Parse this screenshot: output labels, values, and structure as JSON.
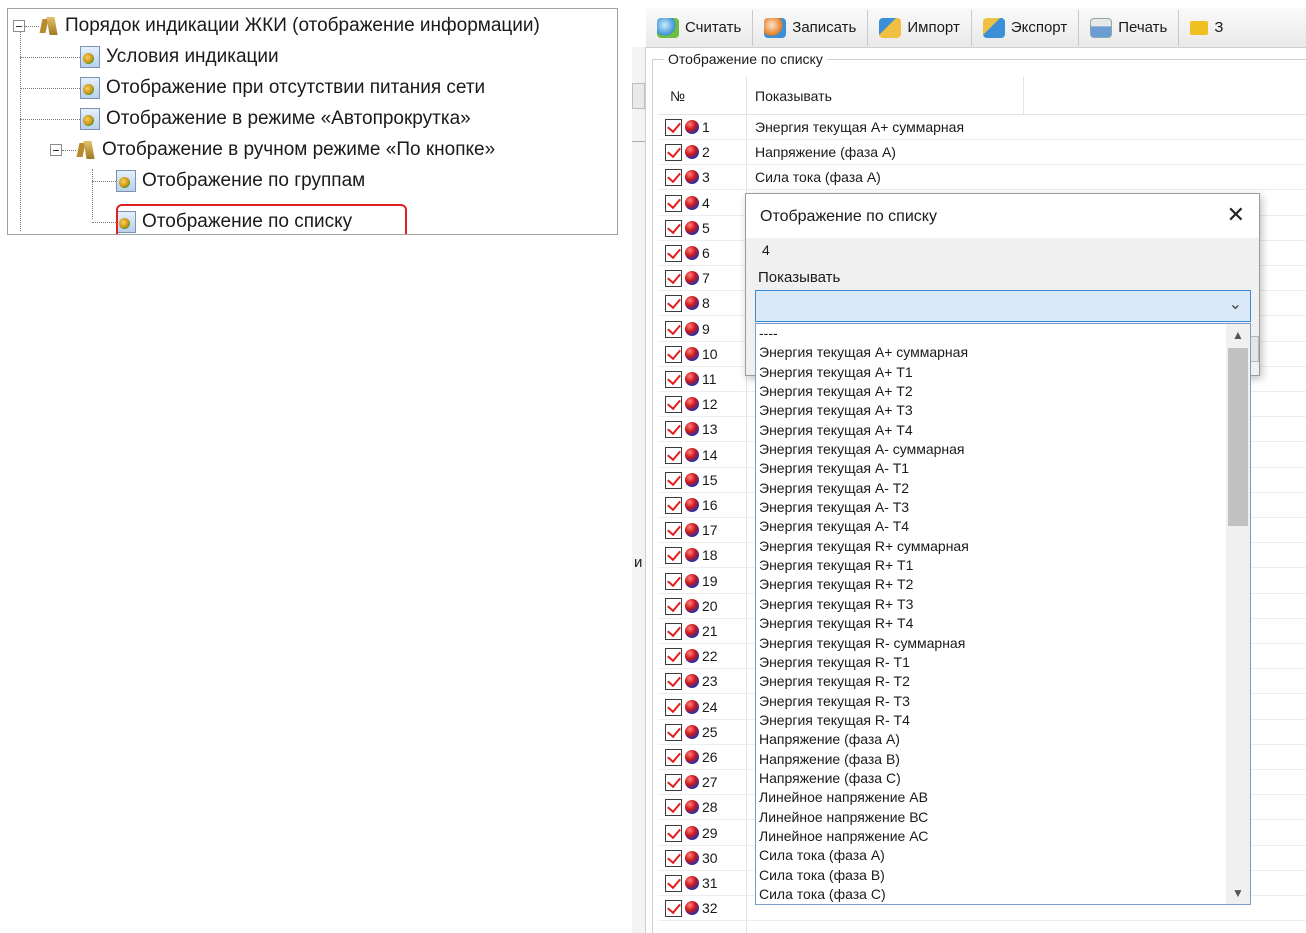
{
  "tree": {
    "root": "Порядок индикации ЖКИ (отображение информации)",
    "items": [
      {
        "label": "Условия индикации"
      },
      {
        "label": "Отображение при отсутствии питания сети"
      },
      {
        "label": "Отображение в режиме «Автопрокрутка»"
      },
      {
        "label": "Отображение в ручном режиме «По кнопке»"
      },
      {
        "label": "Отображение по группам"
      },
      {
        "label": "Отображение по списку"
      }
    ]
  },
  "toolbar": {
    "read": "Считать",
    "write": "Записать",
    "import": "Импорт",
    "export": "Экспорт",
    "print": "Печать",
    "more": "З"
  },
  "panel": {
    "group_title": "Отображение по списку",
    "edge_char": "и",
    "col_num": "№",
    "col_show": "Показывать"
  },
  "rows": [
    {
      "num": "1",
      "show": "Энергия текущая А+ суммарная"
    },
    {
      "num": "2",
      "show": "Напряжение (фаза А)"
    },
    {
      "num": "3",
      "show": "Сила тока (фаза А)"
    },
    {
      "num": "4",
      "show": ""
    },
    {
      "num": "5",
      "show": ""
    },
    {
      "num": "6",
      "show": ""
    },
    {
      "num": "7",
      "show": ""
    },
    {
      "num": "8",
      "show": ""
    },
    {
      "num": "9",
      "show": ""
    },
    {
      "num": "10",
      "show": ""
    },
    {
      "num": "11",
      "show": ""
    },
    {
      "num": "12",
      "show": ""
    },
    {
      "num": "13",
      "show": ""
    },
    {
      "num": "14",
      "show": ""
    },
    {
      "num": "15",
      "show": ""
    },
    {
      "num": "16",
      "show": ""
    },
    {
      "num": "17",
      "show": ""
    },
    {
      "num": "18",
      "show": ""
    },
    {
      "num": "19",
      "show": ""
    },
    {
      "num": "20",
      "show": ""
    },
    {
      "num": "21",
      "show": ""
    },
    {
      "num": "22",
      "show": ""
    },
    {
      "num": "23",
      "show": ""
    },
    {
      "num": "24",
      "show": ""
    },
    {
      "num": "25",
      "show": ""
    },
    {
      "num": "26",
      "show": ""
    },
    {
      "num": "27",
      "show": ""
    },
    {
      "num": "28",
      "show": ""
    },
    {
      "num": "29",
      "show": ""
    },
    {
      "num": "30",
      "show": ""
    },
    {
      "num": "31",
      "show": ""
    },
    {
      "num": "32",
      "show": ""
    }
  ],
  "dialog": {
    "title": "Отображение по списку",
    "close": "✕",
    "number": "4",
    "label": "Показывать",
    "combo_value": "",
    "chevron": "⌄"
  },
  "dropdown": {
    "options": [
      "----",
      "Энергия текущая А+ суммарная",
      "Энергия текущая А+ Т1",
      "Энергия текущая А+ Т2",
      "Энергия текущая А+ Т3",
      "Энергия текущая А+ Т4",
      "Энергия текущая А- суммарная",
      "Энергия текущая А- Т1",
      "Энергия текущая А- Т2",
      "Энергия текущая А- Т3",
      "Энергия текущая А- Т4",
      "Энергия текущая R+ суммарная",
      "Энергия текущая R+ Т1",
      "Энергия текущая R+ Т2",
      "Энергия текущая R+ Т3",
      "Энергия текущая R+ Т4",
      "Энергия текущая R- суммарная",
      "Энергия текущая R- Т1",
      "Энергия текущая R- Т2",
      "Энергия текущая R- Т3",
      "Энергия текущая R- Т4",
      "Напряжение (фаза А)",
      "Напряжение (фаза В)",
      "Напряжение (фаза С)",
      "Линейное напряжение АВ",
      "Линейное напряжение ВС",
      "Линейное напряжение АС",
      "Сила тока (фаза А)",
      "Сила тока (фаза В)",
      "Сила тока (фаза С)"
    ]
  },
  "colors": {
    "accent": "#3b8ad8",
    "highlight_border": "#e02020",
    "check_mark": "#e41b1b"
  }
}
